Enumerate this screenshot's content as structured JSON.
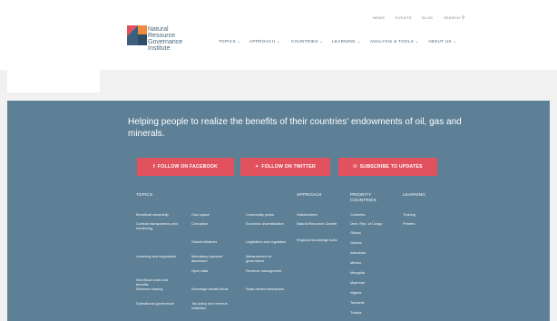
{
  "logo": {
    "lines": [
      "Natural",
      "Resource",
      "Governance",
      "Institute"
    ]
  },
  "util_nav": [
    "NEWS",
    "EVENTS",
    "BLOG",
    "SEARCH"
  ],
  "main_nav": [
    "TOPICS",
    "APPROACH",
    "COUNTRIES",
    "LEARNING",
    "ANALYSIS & TOOLS",
    "ABOUT US"
  ],
  "footer": {
    "tagline": "Helping people to realize the benefits of their countries' endowments of oil, gas and minerals.",
    "buttons": {
      "facebook": "FOLLOW ON FACEBOOK",
      "twitter": "FOLLOW ON TWITTER",
      "subscribe": "SUBSCRIBE TO UPDATES"
    },
    "headers": {
      "topics": "TOPICS",
      "approach": "APPROACH",
      "priority": "PRIORITY COUNTRIES",
      "learning": "LEARNING"
    },
    "topics_col1": [
      "Beneficial ownership",
      "Contract transparency and monitoring",
      "Licensing and negotiation",
      "Non-fiscal costs and benefits",
      "Revenue sharing",
      "Subnational governance"
    ],
    "topics_col2": [
      "Civic space",
      "Corruption",
      "Global initiatives",
      "Mandatory payment disclosure",
      "Open data",
      "Sovereign wealth funds",
      "Tax policy and revenue collection"
    ],
    "topics_col3": [
      "Commodity prices",
      "Economic diversification",
      "Legislation and regulation",
      "Measurement of governance",
      "Revenue management",
      "State-owned enterprises"
    ],
    "approach": [
      "Stakeholders",
      "Natural Resource Charter",
      "Regional knowledge hubs"
    ],
    "priority": [
      "Colombia",
      "Dem. Rep. of Congo",
      "Ghana",
      "Guinea",
      "Indonesia",
      "Mexico",
      "Mongolia",
      "Myanmar",
      "Nigeria",
      "Tanzania",
      "Tunisia"
    ],
    "learning": [
      "Training",
      "Primers"
    ]
  }
}
